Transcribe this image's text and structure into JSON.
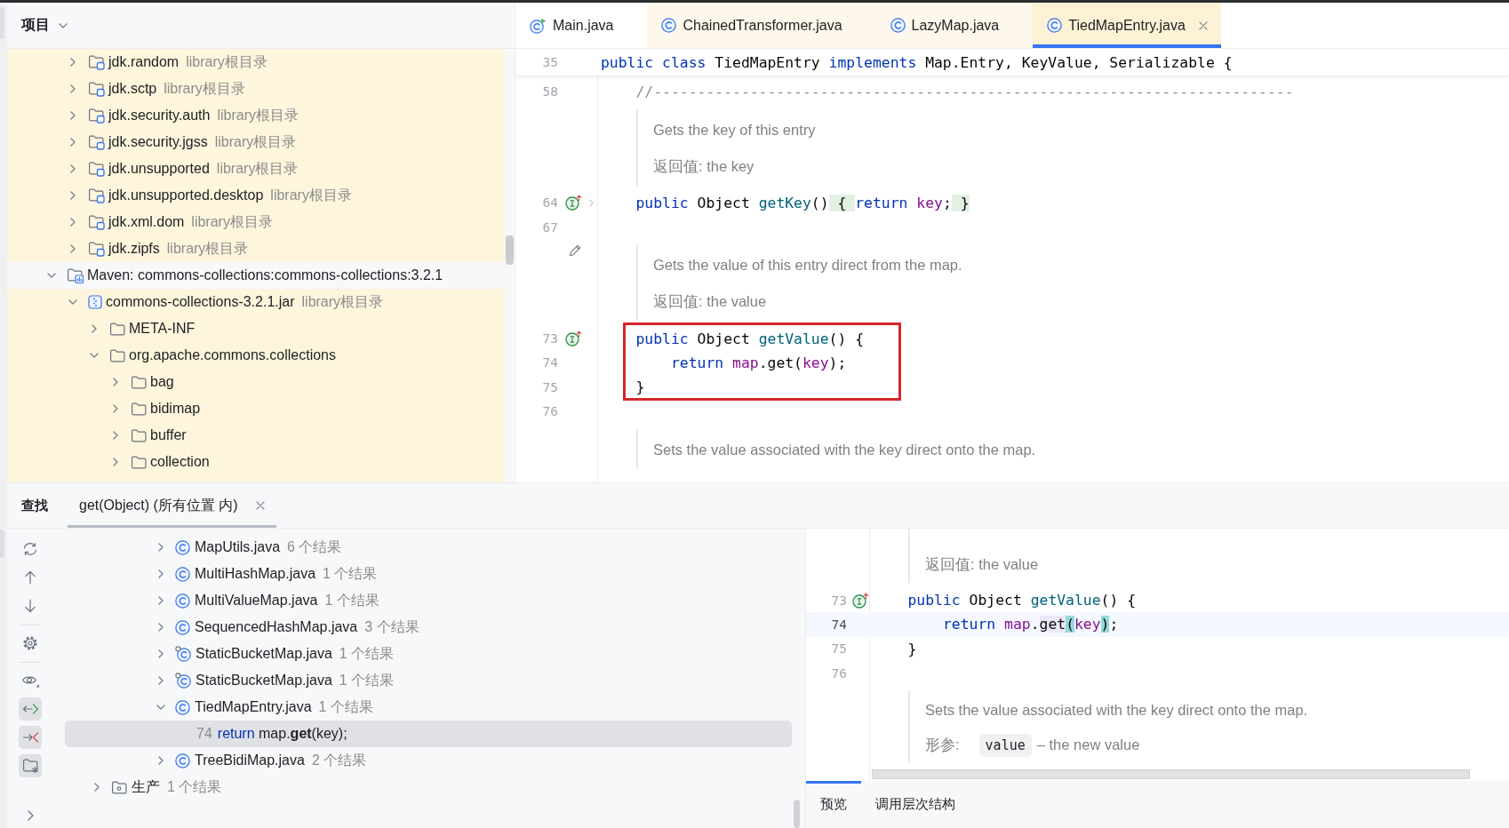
{
  "project_panel": {
    "title": "项目",
    "tree": [
      {
        "children": [
          {
            "label": "jdk.random",
            "note": "library根目录",
            "kind": "module",
            "library": true,
            "expanded": false
          },
          {
            "label": "jdk.sctp",
            "note": "library根目录",
            "kind": "module",
            "library": true,
            "expanded": false
          },
          {
            "label": "jdk.security.auth",
            "note": "library根目录",
            "kind": "module",
            "library": true,
            "expanded": false
          },
          {
            "label": "jdk.security.jgss",
            "note": "library根目录",
            "kind": "module",
            "library": true,
            "expanded": false
          },
          {
            "label": "jdk.unsupported",
            "note": "library根目录",
            "kind": "module",
            "library": true,
            "expanded": false
          },
          {
            "label": "jdk.unsupported.desktop",
            "note": "library根目录",
            "kind": "module",
            "library": true,
            "expanded": false
          },
          {
            "label": "jdk.xml.dom",
            "note": "library根目录",
            "kind": "module",
            "library": true,
            "expanded": false
          },
          {
            "label": "jdk.zipfs",
            "note": "library根目录",
            "kind": "module",
            "library": true,
            "expanded": false
          }
        ]
      },
      {
        "label": "Maven: commons-collections:commons-collections:3.2.1",
        "kind": "maven-library",
        "library": false,
        "expanded": true,
        "children": [
          {
            "label": "commons-collections-3.2.1.jar",
            "note": "library根目录",
            "kind": "jar",
            "library": true,
            "expanded": true,
            "children": [
              {
                "label": "META-INF",
                "kind": "folder",
                "library": true,
                "expanded": false
              },
              {
                "label": "org.apache.commons.collections",
                "kind": "folder",
                "library": true,
                "expanded": true,
                "children": [
                  {
                    "label": "bag",
                    "kind": "folder",
                    "library": true,
                    "expanded": false
                  },
                  {
                    "label": "bidimap",
                    "kind": "folder",
                    "library": true,
                    "expanded": false
                  },
                  {
                    "label": "buffer",
                    "kind": "folder",
                    "library": true,
                    "expanded": false
                  },
                  {
                    "label": "collection",
                    "kind": "folder",
                    "library": true,
                    "expanded": false
                  }
                ]
              }
            ]
          }
        ]
      }
    ]
  },
  "editor": {
    "tabs": [
      {
        "label": "Main.java",
        "kind": "main-class",
        "library": false,
        "selected": false
      },
      {
        "label": "ChainedTransformer.java",
        "kind": "class",
        "library": true,
        "selected": false
      },
      {
        "label": "LazyMap.java",
        "kind": "class",
        "library": true,
        "selected": false
      },
      {
        "label": "TiedMapEntry.java",
        "kind": "class",
        "library": true,
        "selected": true
      }
    ],
    "sticky_line": {
      "number": "35",
      "tokens": [
        {
          "kind": "keyword",
          "text": "public class"
        },
        {
          "kind": "plain",
          "text": " TiedMapEntry "
        },
        {
          "kind": "keyword",
          "text": "implements"
        },
        {
          "kind": "plain",
          "text": " Map.Entry, KeyValue, Serializable {"
        }
      ]
    },
    "blocks": [
      {
        "kind": "code",
        "number": "58",
        "tokens": [
          {
            "kind": "comment",
            "text": "//-------------------------------------------------------------------------"
          }
        ],
        "gutter_marker": false,
        "boxed": false,
        "folded": false
      },
      {
        "kind": "doc",
        "editable": false,
        "lines": [
          {
            "text": "Gets the key of this entry"
          },
          {
            "text": "返回值: the key"
          }
        ]
      },
      {
        "kind": "code",
        "number": "64",
        "tokens": [
          {
            "kind": "keyword",
            "text": "public"
          },
          {
            "kind": "plain",
            "text": " Object "
          },
          {
            "kind": "method",
            "text": "getKey"
          },
          {
            "kind": "plain",
            "text": "()"
          },
          {
            "kind": "fold",
            "text": " { "
          },
          {
            "kind": "keyword",
            "text": "return"
          },
          {
            "kind": "field",
            "text": " key"
          },
          {
            "kind": "plain",
            "text": ";"
          },
          {
            "kind": "fold",
            "text": " }"
          }
        ],
        "gutter_marker": true,
        "boxed": false,
        "folded": true
      },
      {
        "kind": "code",
        "number": "67",
        "gutter_marker": false,
        "boxed": false,
        "folded": false
      },
      {
        "kind": "doc",
        "editable": true,
        "lines": [
          {
            "text": "Gets the value of this entry direct from the map."
          },
          {
            "text": "返回值: the value"
          }
        ]
      },
      {
        "kind": "code",
        "number": "73",
        "tokens": [
          {
            "kind": "keyword",
            "text": "public"
          },
          {
            "kind": "plain",
            "text": " Object "
          },
          {
            "kind": "method",
            "text": "getValue"
          },
          {
            "kind": "plain",
            "text": "() {"
          }
        ],
        "gutter_marker": true,
        "boxed": true,
        "folded": false,
        "children": [
          {
            "kind": "code",
            "number": "74",
            "tokens": [
              {
                "kind": "keyword",
                "text": "return"
              },
              {
                "kind": "field",
                "text": " map"
              },
              {
                "kind": "plain",
                "text": ".get("
              },
              {
                "kind": "field",
                "text": "key"
              },
              {
                "kind": "plain",
                "text": ");"
              }
            ],
            "gutter_marker": false,
            "boxed": true,
            "folded": false
          }
        ]
      },
      {
        "kind": "code",
        "number": "75",
        "tokens": [
          {
            "kind": "plain",
            "text": "}"
          }
        ],
        "gutter_marker": false,
        "boxed": true,
        "folded": false
      },
      {
        "kind": "code",
        "number": "76",
        "gutter_marker": false,
        "boxed": false,
        "folded": false
      },
      {
        "kind": "doc",
        "editable": false,
        "lines": [
          {
            "text": "Sets the value associated with the key direct onto the map."
          }
        ]
      }
    ]
  },
  "find_panel": {
    "title": "查找",
    "tabs": [
      {
        "label": "get(Object) (所有位置 内)",
        "selected": true
      }
    ],
    "toolbar_groups": [
      {
        "buttons": [
          {
            "kind": "rerun",
            "on": false
          },
          {
            "kind": "previous",
            "on": false
          },
          {
            "kind": "next",
            "on": false
          }
        ]
      },
      {
        "buttons": [
          {
            "kind": "settings",
            "on": false
          }
        ]
      },
      {
        "buttons": [
          {
            "kind": "preview",
            "on": false
          },
          {
            "kind": "read-access",
            "on": true
          },
          {
            "kind": "write-access",
            "on": true
          },
          {
            "kind": "scope",
            "on": true
          }
        ]
      }
    ],
    "results": [
      {
        "children": [
          {
            "children": [
              {
                "children": [
                  {
                    "label": "MapUtils.java",
                    "count": "6 个结果",
                    "kind": "class",
                    "expanded": false,
                    "selected": false
                  },
                  {
                    "label": "MultiHashMap.java",
                    "count": "1 个结果",
                    "kind": "class",
                    "expanded": false,
                    "selected": false
                  },
                  {
                    "label": "MultiValueMap.java",
                    "count": "1 个结果",
                    "kind": "class",
                    "expanded": false,
                    "selected": false
                  },
                  {
                    "label": "SequencedHashMap.java",
                    "count": "3 个结果",
                    "kind": "class",
                    "expanded": false,
                    "selected": false
                  },
                  {
                    "label": "StaticBucketMap.java",
                    "count": "1 个结果",
                    "kind": "class-static",
                    "expanded": false,
                    "selected": false
                  },
                  {
                    "label": "StaticBucketMap.java",
                    "count": "1 个结果",
                    "kind": "class-static",
                    "expanded": false,
                    "selected": false
                  },
                  {
                    "label": "TiedMapEntry.java",
                    "count": "1 个结果",
                    "kind": "class",
                    "expanded": true,
                    "selected": false,
                    "children": [
                      {
                        "kind": "usage",
                        "line": "74",
                        "tokens": [
                          {
                            "kind": "keyword",
                            "text": "return"
                          },
                          {
                            "kind": "plain",
                            "text": " map."
                          },
                          {
                            "kind": "hit",
                            "text": "get"
                          },
                          {
                            "kind": "plain",
                            "text": "(key);"
                          }
                        ],
                        "selected": true
                      }
                    ]
                  },
                  {
                    "label": "TreeBidiMap.java",
                    "count": "2 个结果",
                    "kind": "class",
                    "expanded": false,
                    "selected": false
                  }
                ]
              }
            ]
          }
        ]
      },
      {
        "label": "生产",
        "count": "1 个结果",
        "kind": "source-folder",
        "expanded": false,
        "selected": false
      }
    ],
    "preview": {
      "blocks": [
        {
          "kind": "doc",
          "editable": false,
          "lines": [
            {
              "text": "返回值: the value"
            }
          ]
        },
        {
          "kind": "code",
          "number": "73",
          "tokens": [
            {
              "kind": "keyword",
              "text": "public"
            },
            {
              "kind": "plain",
              "text": " Object "
            },
            {
              "kind": "method",
              "text": "getValue"
            },
            {
              "kind": "plain",
              "text": "() {"
            }
          ],
          "gutter_marker": true,
          "current": false,
          "children": [
            {
              "kind": "code",
              "number": "74",
              "tokens": [
                {
                  "kind": "keyword",
                  "text": "return"
                },
                {
                  "kind": "field",
                  "text": " map"
                },
                {
                  "kind": "plain",
                  "text": "."
                },
                {
                  "kind": "usage",
                  "text": "get"
                },
                {
                  "kind": "brace",
                  "text": "("
                },
                {
                  "kind": "field",
                  "text": "key"
                },
                {
                  "kind": "brace",
                  "text": ")"
                },
                {
                  "kind": "plain",
                  "text": ";"
                }
              ],
              "gutter_marker": false,
              "current": true
            }
          ]
        },
        {
          "kind": "code",
          "number": "75",
          "tokens": [
            {
              "kind": "plain",
              "text": "}"
            }
          ],
          "gutter_marker": false,
          "current": false
        },
        {
          "kind": "code",
          "number": "76",
          "gutter_marker": false,
          "current": false
        },
        {
          "kind": "doc",
          "editable": false,
          "lines": [
            {
              "text": "Sets the value associated with the key direct onto the map."
            },
            {
              "label": "形参:",
              "code": "value",
              "text": "– the new value"
            }
          ]
        }
      ],
      "tabs": [
        {
          "label": "预览",
          "selected": true
        },
        {
          "label": "调用层次结构",
          "selected": false
        }
      ]
    }
  }
}
